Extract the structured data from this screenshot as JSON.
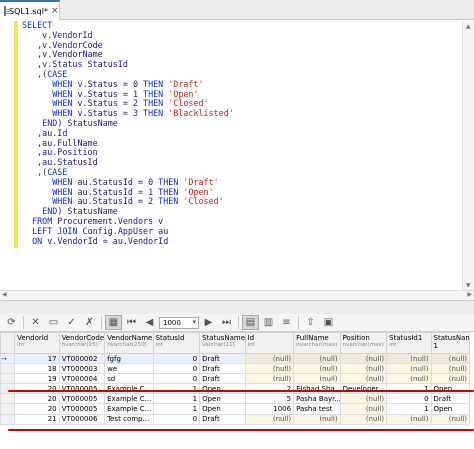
{
  "tab": {
    "label": "SQL1.sql*",
    "close": "×"
  },
  "sql_lines": [
    [
      {
        "t": "SELECT",
        "c": "kw"
      }
    ],
    [
      {
        "t": "    v.VendorId",
        "c": "id"
      }
    ],
    [
      {
        "t": "   ,v.VendorCode",
        "c": "id"
      }
    ],
    [
      {
        "t": "   ,v.VendorName",
        "c": "id"
      }
    ],
    [
      {
        "t": "   ,v.Status StatusId",
        "c": "id"
      }
    ],
    [
      {
        "t": "   ,(",
        "c": "plain"
      },
      {
        "t": "CASE",
        "c": "kw"
      }
    ],
    [
      {
        "t": "      ",
        "c": "plain"
      },
      {
        "t": "WHEN",
        "c": "kw"
      },
      {
        "t": " v.Status = 0 ",
        "c": "id"
      },
      {
        "t": "THEN",
        "c": "kw"
      },
      {
        "t": " ",
        "c": "plain"
      },
      {
        "t": "'Draft'",
        "c": "str"
      }
    ],
    [
      {
        "t": "      ",
        "c": "plain"
      },
      {
        "t": "WHEN",
        "c": "kw"
      },
      {
        "t": " v.Status = 1 ",
        "c": "id"
      },
      {
        "t": "THEN",
        "c": "kw"
      },
      {
        "t": " ",
        "c": "plain"
      },
      {
        "t": "'Open'",
        "c": "str"
      }
    ],
    [
      {
        "t": "      ",
        "c": "plain"
      },
      {
        "t": "WHEN",
        "c": "kw"
      },
      {
        "t": " v.Status = 2 ",
        "c": "id"
      },
      {
        "t": "THEN",
        "c": "kw"
      },
      {
        "t": " ",
        "c": "plain"
      },
      {
        "t": "'Closed'",
        "c": "str"
      }
    ],
    [
      {
        "t": "      ",
        "c": "plain"
      },
      {
        "t": "WHEN",
        "c": "kw"
      },
      {
        "t": " v.Status = 3 ",
        "c": "id"
      },
      {
        "t": "THEN",
        "c": "kw"
      },
      {
        "t": " ",
        "c": "plain"
      },
      {
        "t": "'Blacklisted'",
        "c": "str"
      }
    ],
    [
      {
        "t": "    ",
        "c": "plain"
      },
      {
        "t": "END",
        "c": "kw"
      },
      {
        "t": ") StatusName",
        "c": "id"
      }
    ],
    [
      {
        "t": "   ,au.Id",
        "c": "id"
      }
    ],
    [
      {
        "t": "   ,au.FullName",
        "c": "id"
      }
    ],
    [
      {
        "t": "   ,au.Position",
        "c": "id"
      }
    ],
    [
      {
        "t": "   ,au.StatusId",
        "c": "id"
      }
    ],
    [
      {
        "t": "   ,(",
        "c": "plain"
      },
      {
        "t": "CASE",
        "c": "kw"
      }
    ],
    [
      {
        "t": "      ",
        "c": "plain"
      },
      {
        "t": "WHEN",
        "c": "kw"
      },
      {
        "t": " au.StatusId = 0 ",
        "c": "id"
      },
      {
        "t": "THEN",
        "c": "kw"
      },
      {
        "t": " ",
        "c": "plain"
      },
      {
        "t": "'Draft'",
        "c": "str"
      }
    ],
    [
      {
        "t": "      ",
        "c": "plain"
      },
      {
        "t": "WHEN",
        "c": "kw"
      },
      {
        "t": " au.StatusId = 1 ",
        "c": "id"
      },
      {
        "t": "THEN",
        "c": "kw"
      },
      {
        "t": " ",
        "c": "plain"
      },
      {
        "t": "'Open'",
        "c": "str"
      }
    ],
    [
      {
        "t": "      ",
        "c": "plain"
      },
      {
        "t": "WHEN",
        "c": "kw"
      },
      {
        "t": " au.StatusId = 2 ",
        "c": "id"
      },
      {
        "t": "THEN",
        "c": "kw"
      },
      {
        "t": " ",
        "c": "plain"
      },
      {
        "t": "'Closed'",
        "c": "str"
      }
    ],
    [
      {
        "t": "    ",
        "c": "plain"
      },
      {
        "t": "END",
        "c": "kw"
      },
      {
        "t": ") StatusName",
        "c": "id"
      }
    ],
    [
      {
        "t": "  ",
        "c": "plain"
      },
      {
        "t": "FROM",
        "c": "kw"
      },
      {
        "t": " Procurement.Vendors v",
        "c": "id"
      }
    ],
    [
      {
        "t": "  ",
        "c": "plain"
      },
      {
        "t": "LEFT JOIN",
        "c": "kw"
      },
      {
        "t": " Config.AppUser au",
        "c": "id"
      }
    ],
    [
      {
        "t": "  ",
        "c": "plain"
      },
      {
        "t": "ON",
        "c": "kw"
      },
      {
        "t": " v.VendorId = au.VendorId",
        "c": "id"
      }
    ]
  ],
  "toolbar": {
    "page_size": "1000"
  },
  "grid": {
    "columns": [
      {
        "name": "VendorId",
        "type": "int"
      },
      {
        "name": "VendorCode",
        "type": "nvarchar(25)"
      },
      {
        "name": "VendorName",
        "type": "nvarchar(250)"
      },
      {
        "name": "StatusId",
        "type": "int"
      },
      {
        "name": "StatusName",
        "type": "varchar(11)"
      },
      {
        "name": "Id",
        "type": "int"
      },
      {
        "name": "FullName",
        "type": "nvarchar(max)"
      },
      {
        "name": "Position",
        "type": "nvarchar(max)"
      },
      {
        "name": "StatusId1",
        "type": "int"
      },
      {
        "name": "StatusName 1",
        "type": ""
      }
    ],
    "rows": [
      {
        "marker": "→",
        "cells": [
          "17",
          "VT000002",
          "fgfg",
          "0",
          "Draft",
          "(null)",
          "(null)",
          "(null)",
          "(null)",
          "(null)"
        ]
      },
      {
        "marker": "",
        "cells": [
          "18",
          "VT000003",
          "we",
          "0",
          "Draft",
          "(null)",
          "(null)",
          "(null)",
          "(null)",
          "(null)"
        ]
      },
      {
        "marker": "",
        "cells": [
          "19",
          "VT000004",
          "sd",
          "0",
          "Draft",
          "(null)",
          "(null)",
          "(null)",
          "(null)",
          "(null)"
        ]
      },
      {
        "marker": "",
        "cells": [
          "20",
          "VT000005",
          "Example C...",
          "1",
          "Open",
          "2",
          "Elshad Sha...",
          "Developer",
          "1",
          "Open"
        ]
      },
      {
        "marker": "",
        "cells": [
          "20",
          "VT000005",
          "Example C...",
          "1",
          "Open",
          "5",
          "Pasha Bayr...",
          "(null)",
          "0",
          "Draft"
        ]
      },
      {
        "marker": "",
        "cells": [
          "20",
          "VT000005",
          "Example C...",
          "1",
          "Open",
          "1006",
          "Pasha test",
          "(null)",
          "1",
          "Open"
        ]
      },
      {
        "marker": "",
        "cells": [
          "21",
          "VT000006",
          "Test comp...",
          "0",
          "Draft",
          "(null)",
          "(null)",
          "(null)",
          "(null)",
          "(null)"
        ]
      }
    ]
  },
  "colors": {
    "keyword": "#0b2ed6",
    "string": "#cc1b1b",
    "identifier": "#1a1a8a",
    "change_bar": "#f2e55a",
    "annotation": "#d40000"
  }
}
